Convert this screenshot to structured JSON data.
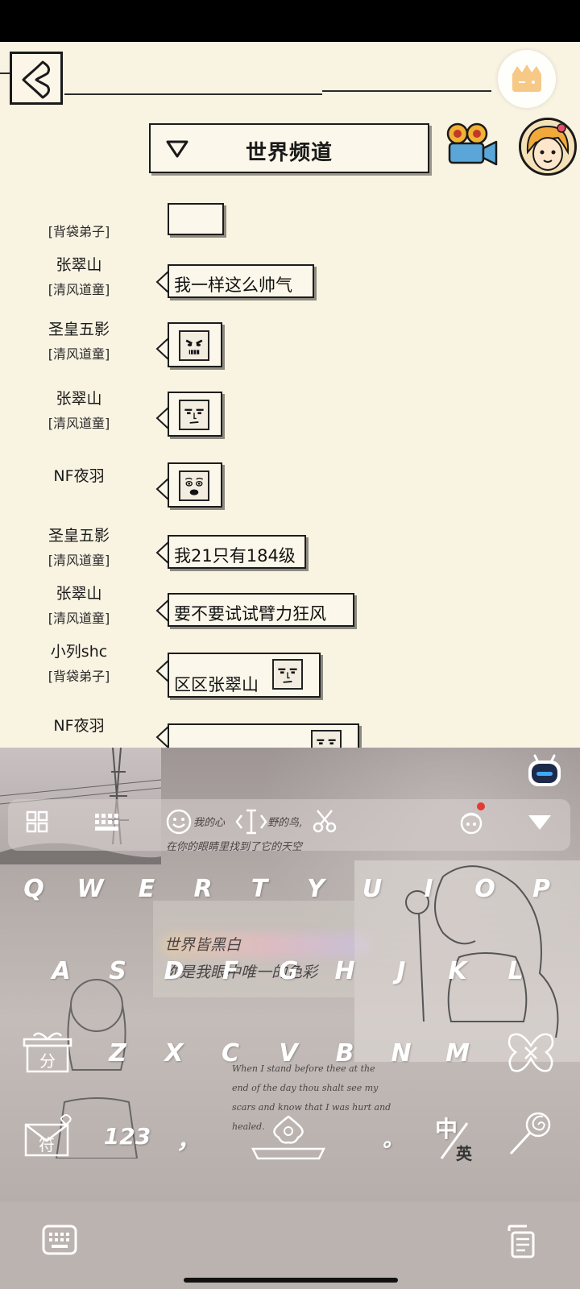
{
  "channel": {
    "title": "世界频道"
  },
  "chat": {
    "top_partial_tag": "[背袋弟子]",
    "messages": [
      {
        "name": "张翠山",
        "tag": "[清风道童]",
        "text": "我一样这么帅气"
      },
      {
        "name": "圣皇五影",
        "tag": "[清风道童]",
        "emote": "angry-face"
      },
      {
        "name": "张翠山",
        "tag": "[清风道童]",
        "emote": "smug-face"
      },
      {
        "name": "NF夜羽",
        "tag": "",
        "emote": "surprised-face"
      },
      {
        "name": "圣皇五影",
        "tag": "[清风道童]",
        "text": "我21只有184级"
      },
      {
        "name": "张翠山",
        "tag": "[清风道童]",
        "text": "要不要试试臂力狂风"
      },
      {
        "name": "小列shc",
        "tag": "[背袋弟子]",
        "text": "区区张翠山",
        "emote": "smug-face"
      },
      {
        "name": "NF夜羽",
        "tag": "",
        "text": "",
        "emote": "smug-face"
      }
    ]
  },
  "keyboard": {
    "row1": [
      "Q",
      "W",
      "E",
      "R",
      "T",
      "Y",
      "U",
      "I",
      "O",
      "P"
    ],
    "row2": [
      "A",
      "S",
      "D",
      "F",
      "G",
      "H",
      "J",
      "K",
      "L"
    ],
    "row3": [
      "Z",
      "X",
      "C",
      "V",
      "B",
      "N",
      "M"
    ],
    "shift_label": "分",
    "symbol_label": "符",
    "num_label": "123",
    "comma_label": "，",
    "period_label": "。",
    "lang_zh": "中",
    "lang_en": "英",
    "theme_text": {
      "line1": "我的心",
      "line1b": "野的鸟,",
      "line2": "在你的眼睛里找到了它的天空",
      "line3": "世界皆黑白",
      "line4": "你是我眼中唯一的色彩",
      "en1": "When I stand before thee at the",
      "en2": "end of the day thou shalt see my",
      "en3": "scars and know that I was hurt and",
      "en4": "healed."
    }
  }
}
